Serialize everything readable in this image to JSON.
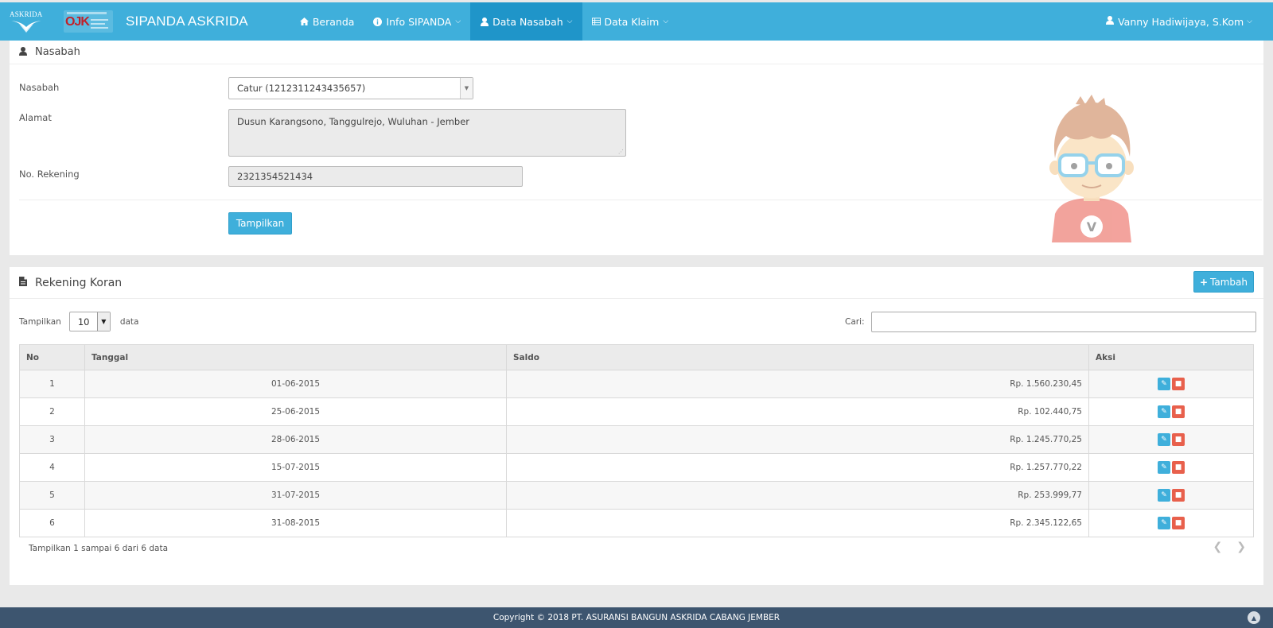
{
  "navbar": {
    "logo_text": "ASKRIDA",
    "ojk_text": "OJK",
    "app_title": "SIPANDA ASKRIDA",
    "menu": [
      {
        "label": "Beranda",
        "icon": "home-icon"
      },
      {
        "label": "Info SIPANDA",
        "icon": "info-icon"
      },
      {
        "label": "Data Nasabah",
        "icon": "user-icon"
      },
      {
        "label": "Data Klaim",
        "icon": "table-icon"
      }
    ],
    "user_name": "Vanny Hadiwijaya, S.Kom"
  },
  "nasabah_panel": {
    "title": "Nasabah",
    "label_nasabah": "Nasabah",
    "label_alamat": "Alamat",
    "label_rekening": "No. Rekening",
    "nasabah_value": "Catur (1212311243435657)",
    "alamat_value": "Dusun Karangsono, Tanggulrejo, Wuluhan - Jember",
    "rekening_value": "2321354521434",
    "show_button": "Tampilkan"
  },
  "rekening_panel": {
    "title": "Rekening Koran",
    "add_button": "Tambah",
    "length_prefix": "Tampilkan",
    "length_value": "10",
    "length_suffix": "data",
    "search_label": "Cari:",
    "columns": [
      "No",
      "Tanggal",
      "Saldo",
      "Aksi"
    ],
    "rows": [
      {
        "no": "1",
        "tanggal": "01-06-2015",
        "saldo": "Rp. 1.560.230,45"
      },
      {
        "no": "2",
        "tanggal": "25-06-2015",
        "saldo": "Rp. 102.440,75"
      },
      {
        "no": "3",
        "tanggal": "28-06-2015",
        "saldo": "Rp. 1.245.770,25"
      },
      {
        "no": "4",
        "tanggal": "15-07-2015",
        "saldo": "Rp. 1.257.770,22"
      },
      {
        "no": "5",
        "tanggal": "31-07-2015",
        "saldo": "Rp. 253.999,77"
      },
      {
        "no": "6",
        "tanggal": "31-08-2015",
        "saldo": "Rp. 2.345.122,65"
      }
    ],
    "info_text": "Tampilkan 1 sampai 6 dari 6 data"
  },
  "footer": {
    "copyright": "Copyright © 2018 PT. ASURANSI BANGUN ASKRIDA CABANG JEMBER"
  },
  "colors": {
    "primary": "#3fafdb",
    "primary_active": "#1f95c9",
    "danger": "#e8604c",
    "footer": "#3d556f"
  }
}
